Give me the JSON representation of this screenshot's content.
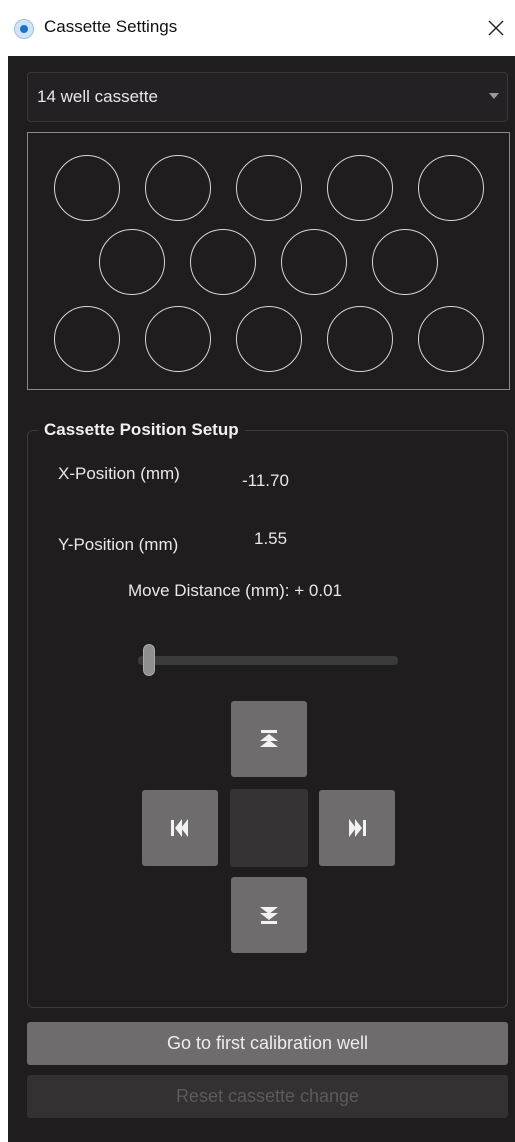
{
  "window": {
    "title": "Cassette Settings",
    "close_icon": "close-icon",
    "app_icon": "app-record-icon"
  },
  "cassette_select": {
    "selected": "14 well cassette"
  },
  "wells": {
    "count": 14,
    "rows": [
      5,
      4,
      5
    ]
  },
  "position_setup": {
    "title": "Cassette Position Setup",
    "x_label": "X-Position (mm)",
    "x_value": "-11.70",
    "y_label": "Y-Position (mm)",
    "y_value": "1.55",
    "move_distance_label": "Move Distance (mm): + 0.01",
    "slider_level": 0.0
  },
  "jog_buttons": {
    "up_icon": "skip-to-top-icon",
    "down_icon": "skip-to-bottom-icon",
    "left_icon": "skip-back-icon",
    "right_icon": "skip-forward-icon"
  },
  "actions": {
    "first_calibration_label": "Go to first calibration well",
    "reset_label": "Reset cassette change"
  },
  "colors": {
    "panel_bg": "#1f1d1e",
    "button_bg": "#6e6c6d",
    "disabled_bg": "#333132",
    "accent": "#1a73c9"
  }
}
